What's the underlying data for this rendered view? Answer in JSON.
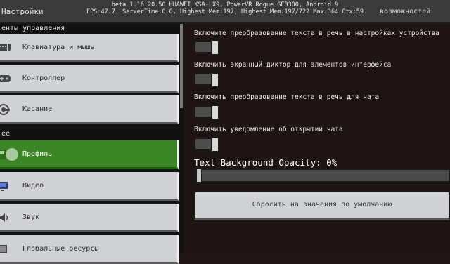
{
  "header": {
    "title": "Настройки",
    "debug_line1": "beta 1.16.20.50 HUAWEI KSA-LX9, PowerVR Rogue GE8300, Android 9",
    "debug_line2": "FPS:47.7, ServerTime:0.0, Highest Mem:197, Highest Mem:197/722 Max:364 Ctx:59",
    "right_title": "возможностей"
  },
  "sidebar": {
    "section_controls": "енты управления",
    "section_general": "ее",
    "items": [
      {
        "label": "Клавиатура и мышь",
        "icon": "keyboard-mouse-icon"
      },
      {
        "label": "Контроллер",
        "icon": "controller-icon"
      },
      {
        "label": "Касание",
        "icon": "touch-icon"
      },
      {
        "label": "Профиль",
        "icon": "profile-icon"
      },
      {
        "label": "Видео",
        "icon": "video-icon"
      },
      {
        "label": "Звук",
        "icon": "sound-icon"
      },
      {
        "label": "Глобальные ресурсы",
        "icon": "global-resources-icon"
      }
    ]
  },
  "options": [
    {
      "label": "Включите преобразование текста в речь в настройках устройства",
      "on": false
    },
    {
      "label": "Включить экранный диктор для элементов интерфейса",
      "on": false
    },
    {
      "label": "Включить преобразование текста в речь для чата",
      "on": false
    },
    {
      "label": "Включить уведомление об открытии чата",
      "on": false
    }
  ],
  "opacity": {
    "label": "Text Background Opacity: 0%",
    "value": 0
  },
  "reset_label": "Сбросить на значения по умолчанию"
}
